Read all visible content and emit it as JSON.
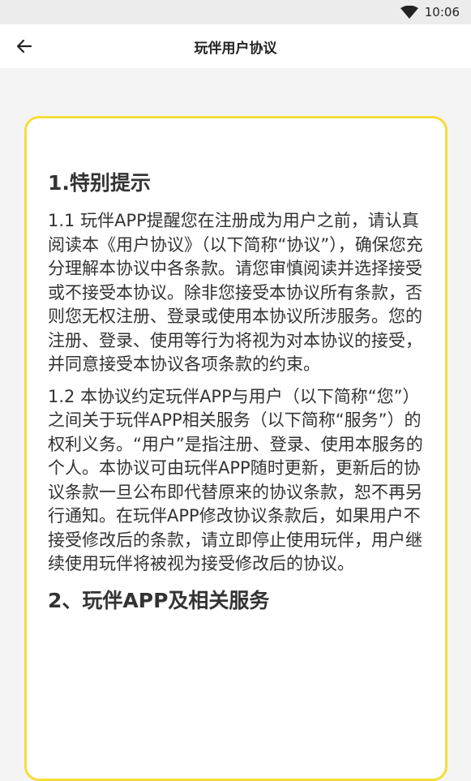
{
  "status_bar": {
    "time": "10:06",
    "wifi_icon": "wifi-icon"
  },
  "app_bar": {
    "back_icon": "arrow-left-icon",
    "title": "玩伴用户协议"
  },
  "content": {
    "heading_1": "1.特别提示",
    "para_1_1": "1.1 玩伴APP提醒您在注册成为用户之前，请认真阅读本《用户协议》（以下简称“协议”），确保您充分理解本协议中各条款。请您审慎阅读并选择接受或不接受本协议。除非您接受本协议所有条款，否则您无权注册、登录或使用本协议所涉服务。您的注册、登录、使用等行为将视为对本协议的接受，并同意接受本协议各项条款的约束。",
    "para_1_2": "1.2 本协议约定玩伴APP与用户（以下简称“您”）之间关于玩伴APP相关服务（以下简称“服务”）的权利义务。“用户”是指注册、登录、使用本服务的个人。本协议可由玩伴APP随时更新，更新后的协议条款一旦公布即代替原来的协议条款，恕不再另行通知。在玩伴APP修改协议条款后，如果用户不接受修改后的条款，请立即停止使用玩伴，用户继续使用玩伴将被视为接受修改后的协议。",
    "heading_2": "2、玩伴APP及相关服务"
  },
  "colors": {
    "card_border": "#f6dc3a",
    "background": "#f4f4f4"
  }
}
